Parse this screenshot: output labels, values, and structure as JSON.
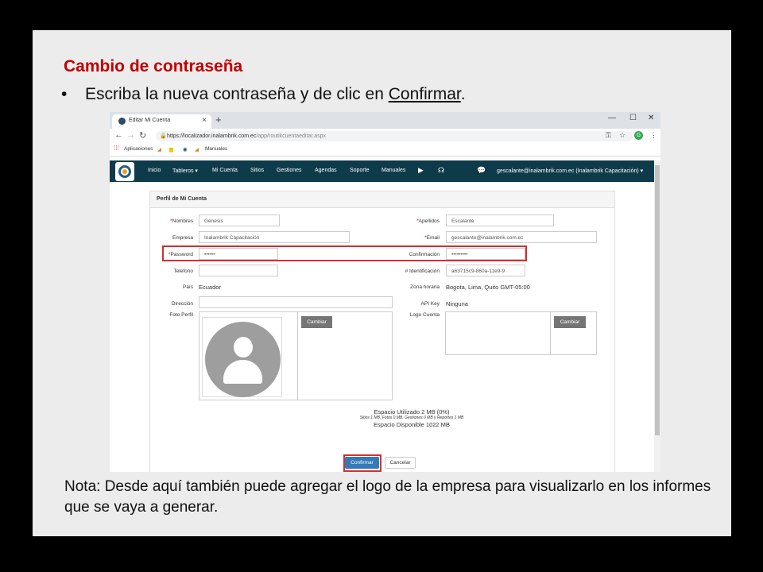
{
  "slide": {
    "title": "Cambio de contraseña",
    "bullet_prefix": "Escriba la nueva contraseña y de clic en ",
    "bullet_link": "Confirmar",
    "bullet_suffix": ".",
    "note": "Nota: Desde aquí también puede agregar el logo de la empresa para visualizarlo en los informes que se vaya a generar."
  },
  "browser": {
    "tab_title": "Editar Mi Cuenta",
    "tab_close": "×",
    "new_tab": "+",
    "url_host": "https://localizador.inalambrik.com.ec",
    "url_path": "/app/routikcuentaeditar.aspx",
    "bookmarks": [
      "Aplicaciones",
      "Manuales"
    ],
    "profile_initial": "G"
  },
  "nav": {
    "items": [
      "Inicio",
      "Tableros ▾",
      "Mi Cuenta",
      "Sitios",
      "Gestiones",
      "Agendas",
      "Soporte",
      "Manuales"
    ],
    "user": "gescalante@inalambrik.com.ec (Inalambrik Capacitación) ▾"
  },
  "form": {
    "panel_title": "Perfil de Mi Cuenta",
    "labels": {
      "nombres": "Nombres",
      "apellidos": "Apellidos",
      "empresa": "Empresa",
      "email": "Email",
      "password": "Password",
      "confirmacion": "Confirmación",
      "telefono": "Telefono",
      "identificacion": "# Identificación",
      "pais": "País",
      "zona": "Zona horaria",
      "direccion": "Dirección",
      "apikey": "API Key",
      "foto": "Foto Perfil",
      "logo": "Logo Cuenta"
    },
    "values": {
      "nombres": "Génesis",
      "apellidos": "Escalante",
      "empresa": "Inalambrik Capacitación",
      "email": "gescalante@inalambrik.com.ec",
      "password": "••••••",
      "confirmacion": "•••••••••",
      "telefono": "",
      "identificacion": "a63715c9-860a-11e9-9",
      "pais": "Ecuador",
      "zona": "Bogota, Lima, Quito GMT-05:00",
      "direccion": "",
      "apikey": "Ninguna"
    },
    "cambiar_label": "Cambiar",
    "space_used": "Espacio Utilizado 2 MB (0%)",
    "space_detail": "Sitios 1 MB, Fotos 0 MB, Gestiones 0 MB y Reportes 1 MB",
    "space_available": "Espacio Disponible 1022 MB",
    "confirm_label": "Confirmar",
    "cancel_label": "Cancelar"
  },
  "colors": {
    "title_red": "#c00000",
    "nav_bg": "#0d3b4a",
    "highlight": "#d32f2f",
    "primary": "#337ab7"
  }
}
